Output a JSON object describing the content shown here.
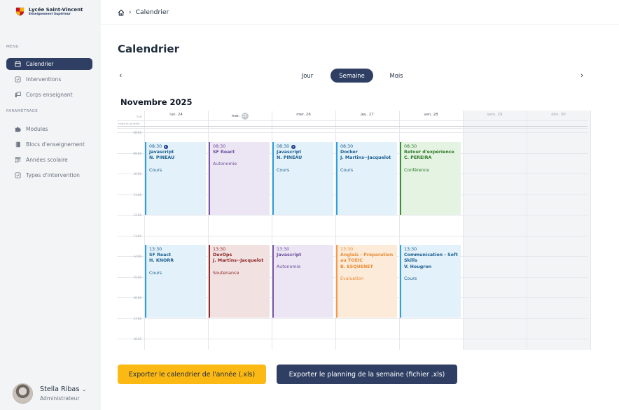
{
  "brand": {
    "name": "Lycée Saint-Vincent",
    "subtitle": "Enseignement Supérieur"
  },
  "sidebar": {
    "menu_label": "MENU",
    "menu_items": [
      {
        "label": "Calendrier",
        "icon": "calendar-icon",
        "active": true
      },
      {
        "label": "Interventions",
        "icon": "list-check-icon",
        "active": false
      },
      {
        "label": "Corps enseignant",
        "icon": "teacher-icon",
        "active": false
      }
    ],
    "settings_label": "PARAMÉTRAGE",
    "settings_items": [
      {
        "label": "Modules",
        "icon": "puzzle-icon"
      },
      {
        "label": "Blocs d'enseignement",
        "icon": "book-icon"
      },
      {
        "label": "Années scolaire",
        "icon": "calendar-grid-icon"
      },
      {
        "label": "Types d'intervention",
        "icon": "list-check-icon"
      }
    ]
  },
  "user": {
    "name": "Stella Ribas",
    "role": "Administrateur"
  },
  "header": {
    "breadcrumb": "Calendrier"
  },
  "page": {
    "title": "Calendrier"
  },
  "views": {
    "items": [
      "Jour",
      "Semaine",
      "Mois"
    ],
    "active": "Semaine",
    "prev": "‹",
    "next": "›"
  },
  "calendar": {
    "month_title": "Novembre 2025",
    "week_label": "S48",
    "allday_label": "toute la journée",
    "days": [
      {
        "label": "lun. 24",
        "weekend": false
      },
      {
        "label": "mar.",
        "badge": "25",
        "weekend": false
      },
      {
        "label": "mer. 26",
        "weekend": false
      },
      {
        "label": "jeu. 27",
        "weekend": false
      },
      {
        "label": "ven. 28",
        "weekend": false
      },
      {
        "label": "sam. 29",
        "weekend": true
      },
      {
        "label": "dim. 30",
        "weekend": true
      }
    ],
    "times": [
      "08:00",
      "09:00",
      "10:00",
      "11:00",
      "12:00",
      "13:00",
      "14:00",
      "15:00",
      "16:00",
      "17:00",
      "18:00"
    ],
    "events": [
      {
        "day": 0,
        "slot": "morning",
        "time": "08:30",
        "icon": true,
        "title": "Javascript",
        "who": "N. PINEAU",
        "type": "Cours",
        "color": "blue"
      },
      {
        "day": 1,
        "slot": "morning",
        "time": "08:30",
        "icon": false,
        "title": "SF React",
        "who": "",
        "type": "Autonomie",
        "color": "purple"
      },
      {
        "day": 2,
        "slot": "morning",
        "time": "08:30",
        "icon": true,
        "title": "Javascript",
        "who": "N. PINEAU",
        "type": "Cours",
        "color": "blue"
      },
      {
        "day": 3,
        "slot": "morning",
        "time": "08:30",
        "icon": false,
        "title": "Docker",
        "who": "J. Martins--Jacquelot",
        "type": "Cours",
        "color": "blue"
      },
      {
        "day": 4,
        "slot": "morning",
        "time": "08:30",
        "icon": false,
        "title": "Retour d'expérience",
        "who": "C. PEREIRA",
        "type": "Conférence",
        "color": "green"
      },
      {
        "day": 0,
        "slot": "afternoon",
        "time": "13:30",
        "icon": false,
        "title": "SF React",
        "who": "H. KNORR",
        "type": "Cours",
        "color": "blue"
      },
      {
        "day": 1,
        "slot": "afternoon",
        "time": "13:30",
        "icon": false,
        "title": "DevOps",
        "who": "J. Martins--Jacquelot",
        "type": "Soutenance",
        "color": "red"
      },
      {
        "day": 2,
        "slot": "afternoon",
        "time": "13:30",
        "icon": false,
        "title": "Javascript",
        "who": "",
        "type": "Autonomie",
        "color": "purple"
      },
      {
        "day": 3,
        "slot": "afternoon",
        "time": "13:30",
        "icon": false,
        "title": "Anglais - Préparation au TOEIC",
        "who": "B. ESQUENET",
        "type": "Évaluation",
        "color": "orange"
      },
      {
        "day": 4,
        "slot": "afternoon",
        "time": "13:30",
        "icon": false,
        "title": "Communication - Soft Skills",
        "who": "V. Hougron",
        "type": "Cours",
        "color": "blue"
      }
    ]
  },
  "actions": {
    "export_year": "Exporter le calendrier de l'année (.xls)",
    "export_week": "Exporter le planning de la semaine (fichier .xls)"
  },
  "colors": {
    "navy": "#2f3f63",
    "yellow": "#fcb813",
    "sidebar_bg": "#f3f4f6"
  }
}
